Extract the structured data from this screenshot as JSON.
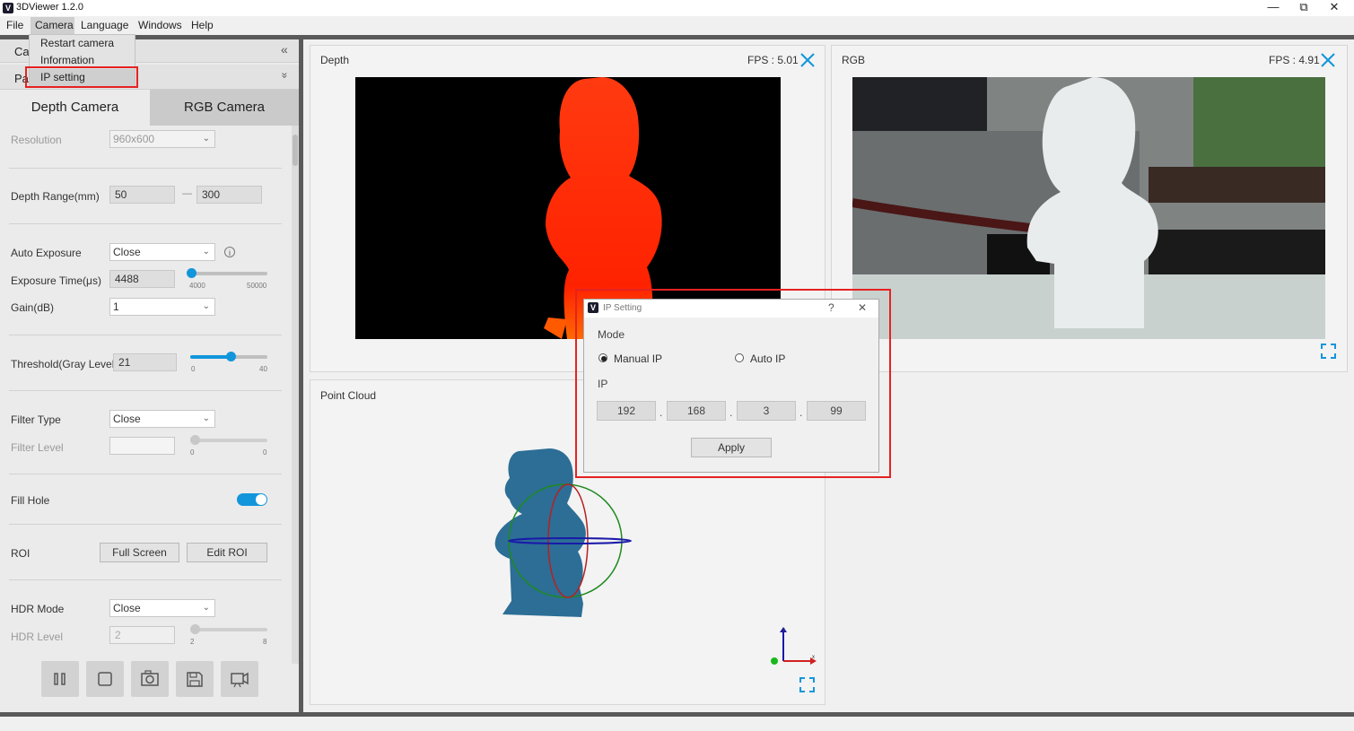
{
  "window": {
    "title": "3DViewer 1.2.0",
    "icon_letter": "V",
    "minimize": "—",
    "restore": "⧉",
    "close": "✕"
  },
  "menubar": {
    "items": [
      "File",
      "Camera",
      "Language",
      "Windows",
      "Help"
    ]
  },
  "camera_menu": {
    "items": [
      "Restart camera",
      "Information",
      "IP setting"
    ]
  },
  "left_panel": {
    "section1_partial": "Ca",
    "section2_partial": "Pa",
    "collapse_icon_1": "«",
    "collapse_icon_2": "»",
    "tabs": {
      "depth": "Depth Camera",
      "rgb": "RGB Camera"
    },
    "resolution": {
      "label": "Resolution",
      "value": "960x600"
    },
    "depth_range": {
      "label": "Depth Range(mm)",
      "min": "50",
      "dash": "—",
      "max": "300"
    },
    "auto_exposure": {
      "label": "Auto Exposure",
      "value": "Close",
      "info": "i"
    },
    "exposure_time": {
      "label": "Exposure Time(μs)",
      "value": "4488",
      "min_tick": "4000",
      "max_tick": "50000",
      "level": 0.01
    },
    "gain": {
      "label": "Gain(dB)",
      "value": "1"
    },
    "threshold": {
      "label": "Threshold(Gray Level)",
      "value": "21",
      "min_tick": "0",
      "max_tick": "40",
      "level": 0.525
    },
    "filter_type": {
      "label": "Filter Type",
      "value": "Close"
    },
    "filter_level": {
      "label": "Filter Level",
      "value": "",
      "min_tick": "0",
      "max_tick": "0"
    },
    "fill_hole": {
      "label": "Fill Hole",
      "on": true
    },
    "roi": {
      "label": "ROI",
      "full_screen": "Full Screen",
      "edit_roi": "Edit ROI"
    },
    "hdr_mode": {
      "label": "HDR Mode",
      "value": "Close"
    },
    "hdr_level": {
      "label": "HDR Level",
      "value": "2",
      "min_tick": "2",
      "max_tick": "8"
    },
    "toolbar_icons": [
      "pause-icon",
      "stop-icon",
      "capture-icon",
      "save-icon",
      "record-icon"
    ]
  },
  "views": {
    "depth": {
      "title": "Depth",
      "fps": "FPS : 5.01"
    },
    "rgb": {
      "title": "RGB",
      "fps": "FPS : 4.91"
    },
    "point_cloud": {
      "title": "Point Cloud"
    }
  },
  "ip_dialog": {
    "title": "IP Setting",
    "help": "?",
    "close": "✕",
    "mode_label": "Mode",
    "manual_ip": "Manual IP",
    "auto_ip": "Auto IP",
    "selected_mode": "Manual IP",
    "ip_label": "IP",
    "ip_octets": [
      "192",
      "168",
      "3",
      "99"
    ],
    "apply": "Apply"
  },
  "colors": {
    "accent": "#1296db",
    "highlight_box": "#e52222",
    "depth_red": "#ff2a00",
    "pointcloud_blue": "#2c6e96"
  }
}
